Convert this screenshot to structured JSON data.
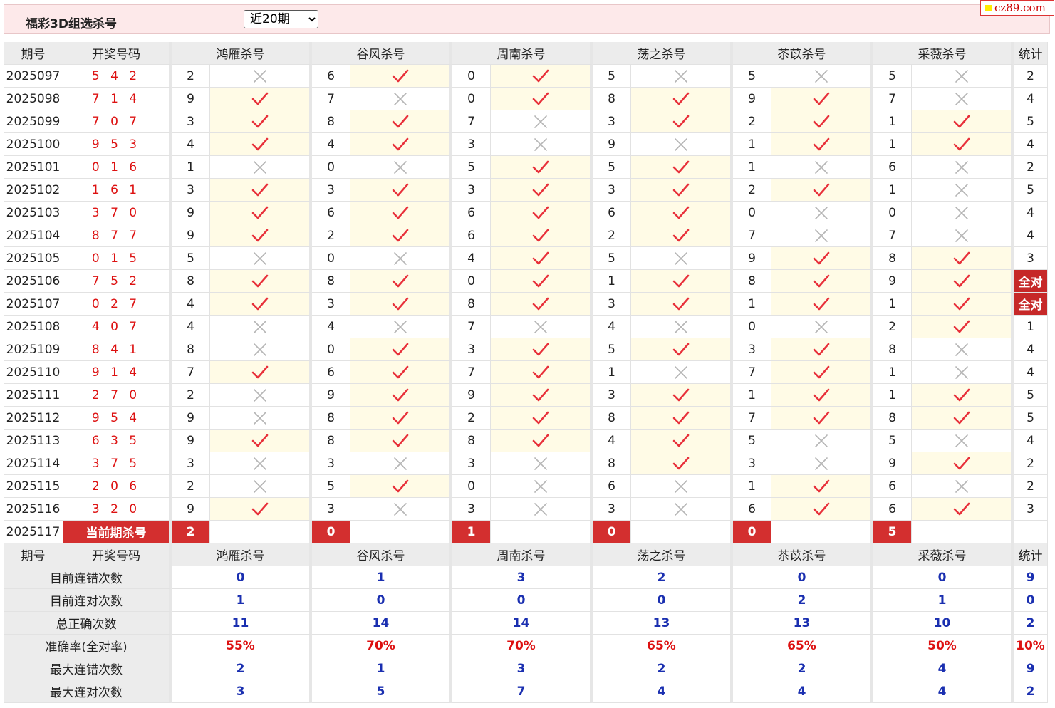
{
  "header": {
    "title": "福彩3D组选杀号",
    "period_option": "近20期",
    "brand": "cz89.com"
  },
  "columns": {
    "period": "期号",
    "winning": "开奖号码",
    "experts": [
      "鸿雁杀号",
      "谷风杀号",
      "周南杀号",
      "荡之杀号",
      "苶苡杀号",
      "采薇杀号"
    ],
    "count": "统计"
  },
  "rows": [
    {
      "period": "2025097",
      "win": "5 4 2",
      "k": [
        2,
        6,
        0,
        5,
        5,
        5
      ],
      "ok": [
        0,
        1,
        1,
        0,
        0,
        0
      ],
      "c": "2"
    },
    {
      "period": "2025098",
      "win": "7 1 4",
      "k": [
        9,
        7,
        0,
        8,
        9,
        7
      ],
      "ok": [
        1,
        0,
        1,
        1,
        1,
        0
      ],
      "c": "4"
    },
    {
      "period": "2025099",
      "win": "7 0 7",
      "k": [
        3,
        8,
        7,
        3,
        2,
        1
      ],
      "ok": [
        1,
        1,
        0,
        1,
        1,
        1
      ],
      "c": "5"
    },
    {
      "period": "2025100",
      "win": "9 5 3",
      "k": [
        4,
        4,
        3,
        9,
        1,
        1
      ],
      "ok": [
        1,
        1,
        0,
        0,
        1,
        1
      ],
      "c": "4"
    },
    {
      "period": "2025101",
      "win": "0 1 6",
      "k": [
        1,
        0,
        5,
        5,
        1,
        6
      ],
      "ok": [
        0,
        0,
        1,
        1,
        0,
        0
      ],
      "c": "2"
    },
    {
      "period": "2025102",
      "win": "1 6 1",
      "k": [
        3,
        3,
        3,
        3,
        2,
        1
      ],
      "ok": [
        1,
        1,
        1,
        1,
        1,
        0
      ],
      "c": "5"
    },
    {
      "period": "2025103",
      "win": "3 7 0",
      "k": [
        9,
        6,
        6,
        6,
        0,
        0
      ],
      "ok": [
        1,
        1,
        1,
        1,
        0,
        0
      ],
      "c": "4"
    },
    {
      "period": "2025104",
      "win": "8 7 7",
      "k": [
        9,
        2,
        6,
        2,
        7,
        7
      ],
      "ok": [
        1,
        1,
        1,
        1,
        0,
        0
      ],
      "c": "4"
    },
    {
      "period": "2025105",
      "win": "0 1 5",
      "k": [
        5,
        0,
        4,
        5,
        9,
        8
      ],
      "ok": [
        0,
        0,
        1,
        0,
        1,
        1
      ],
      "c": "3"
    },
    {
      "period": "2025106",
      "win": "7 5 2",
      "k": [
        8,
        8,
        0,
        1,
        8,
        9
      ],
      "ok": [
        1,
        1,
        1,
        1,
        1,
        1
      ],
      "c": "全对"
    },
    {
      "period": "2025107",
      "win": "0 2 7",
      "k": [
        4,
        3,
        8,
        3,
        1,
        1
      ],
      "ok": [
        1,
        1,
        1,
        1,
        1,
        1
      ],
      "c": "全对"
    },
    {
      "period": "2025108",
      "win": "4 0 7",
      "k": [
        4,
        4,
        7,
        4,
        0,
        2
      ],
      "ok": [
        0,
        0,
        0,
        0,
        0,
        1
      ],
      "c": "1"
    },
    {
      "period": "2025109",
      "win": "8 4 1",
      "k": [
        8,
        0,
        3,
        5,
        3,
        8
      ],
      "ok": [
        0,
        1,
        1,
        1,
        1,
        0
      ],
      "c": "4"
    },
    {
      "period": "2025110",
      "win": "9 1 4",
      "k": [
        7,
        6,
        7,
        1,
        7,
        1
      ],
      "ok": [
        1,
        1,
        1,
        0,
        1,
        0
      ],
      "c": "4"
    },
    {
      "period": "2025111",
      "win": "2 7 0",
      "k": [
        2,
        9,
        9,
        3,
        1,
        1
      ],
      "ok": [
        0,
        1,
        1,
        1,
        1,
        1
      ],
      "c": "5"
    },
    {
      "period": "2025112",
      "win": "9 5 4",
      "k": [
        9,
        8,
        2,
        8,
        7,
        8
      ],
      "ok": [
        0,
        1,
        1,
        1,
        1,
        1
      ],
      "c": "5"
    },
    {
      "period": "2025113",
      "win": "6 3 5",
      "k": [
        9,
        8,
        8,
        4,
        5,
        5
      ],
      "ok": [
        1,
        1,
        1,
        1,
        0,
        0
      ],
      "c": "4"
    },
    {
      "period": "2025114",
      "win": "3 7 5",
      "k": [
        3,
        3,
        3,
        8,
        3,
        9
      ],
      "ok": [
        0,
        0,
        0,
        1,
        0,
        1
      ],
      "c": "2"
    },
    {
      "period": "2025115",
      "win": "2 0 6",
      "k": [
        2,
        5,
        0,
        6,
        1,
        6
      ],
      "ok": [
        0,
        1,
        0,
        0,
        1,
        0
      ],
      "c": "2"
    },
    {
      "period": "2025116",
      "win": "3 2 0",
      "k": [
        9,
        3,
        3,
        3,
        6,
        6
      ],
      "ok": [
        1,
        0,
        0,
        0,
        1,
        1
      ],
      "c": "3"
    }
  ],
  "current": {
    "period": "2025117",
    "label": "当前期杀号",
    "k": [
      2,
      0,
      1,
      0,
      0,
      5
    ]
  },
  "stats": [
    {
      "label": "目前连错次数",
      "v": [
        "0",
        "1",
        "3",
        "2",
        "0",
        "0"
      ],
      "c": "9"
    },
    {
      "label": "目前连对次数",
      "v": [
        "1",
        "0",
        "0",
        "0",
        "2",
        "1"
      ],
      "c": "0"
    },
    {
      "label": "总正确次数",
      "v": [
        "11",
        "14",
        "14",
        "13",
        "13",
        "10"
      ],
      "c": "2"
    },
    {
      "label": "准确率(全对率)",
      "v": [
        "55%",
        "70%",
        "70%",
        "65%",
        "65%",
        "50%"
      ],
      "c": "10%",
      "pct": true
    },
    {
      "label": "最大连错次数",
      "v": [
        "2",
        "1",
        "3",
        "2",
        "2",
        "4"
      ],
      "c": "9"
    },
    {
      "label": "最大连对次数",
      "v": [
        "3",
        "5",
        "7",
        "4",
        "4",
        "4"
      ],
      "c": "2"
    }
  ],
  "colors": {
    "correct": "#e8303a",
    "wrong": "#b5b5b5",
    "highlight": "#c62828",
    "stat_blue": "#1a2fb0"
  },
  "icons": {
    "correct": "check-icon",
    "wrong": "cross-icon"
  }
}
